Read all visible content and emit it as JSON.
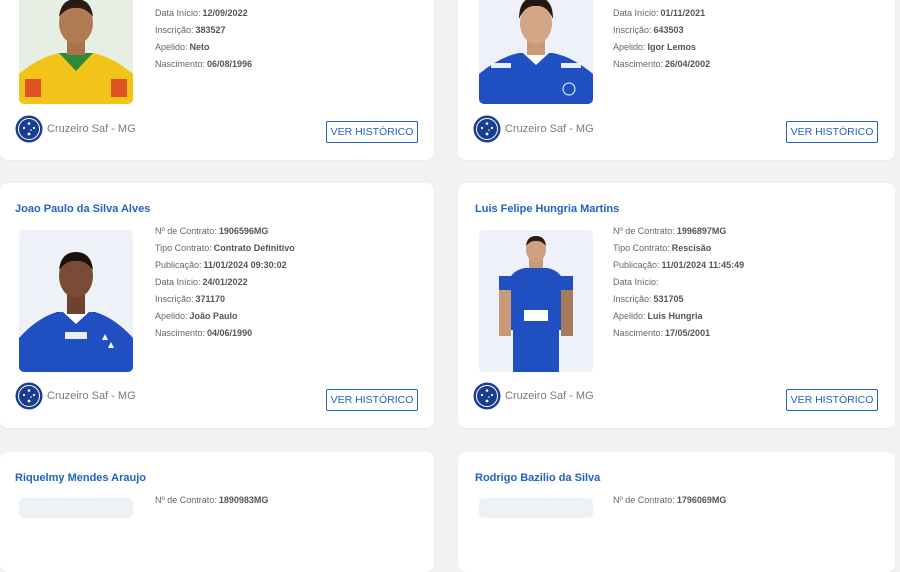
{
  "labels": {
    "contract_no": "Nº de Contrato:",
    "contract_type": "Tipo Contrato:",
    "publication": "Publicação:",
    "start_date": "Data Início:",
    "registration": "Inscrição:",
    "nickname": "Apelido:",
    "birth": "Nascimento:",
    "history_button": "VER HISTÓRICO"
  },
  "club": {
    "name": "Cruzeiro Saf - MG"
  },
  "colors": {
    "accent": "#2163c0",
    "cruzeiro_blue": "#1b3d8f"
  },
  "players": [
    {
      "name": "",
      "contract_no": "",
      "contract_type": "",
      "publication": "",
      "start_date": "12/09/2022",
      "registration": "383527",
      "nickname": "Neto",
      "birth": "06/08/1996",
      "photo": "player-photo-yellow-kit"
    },
    {
      "name": "",
      "contract_no": "",
      "contract_type": "",
      "publication": "",
      "start_date": "01/11/2021",
      "registration": "643503",
      "nickname": "Igor Lemos",
      "birth": "26/04/2002",
      "photo": "player-photo-blue-kit"
    },
    {
      "name": "Joao Paulo da Silva Alves",
      "contract_no": "1906596MG",
      "contract_type": "Contrato Definitivo",
      "publication": "11/01/2024 09:30:02",
      "start_date": "24/01/2022",
      "registration": "371170",
      "nickname": "João Paulo",
      "birth": "04/06/1990",
      "photo": "player-photo-blue-kit"
    },
    {
      "name": "Luis Felipe Hungria Martins",
      "contract_no": "1996897MG",
      "contract_type": "Rescisão",
      "publication": "11/01/2024 11:45:49",
      "start_date": "",
      "registration": "531705",
      "nickname": "Luis Hungria",
      "birth": "17/05/2001",
      "photo": "player-photo-full-body-blue-kit"
    },
    {
      "name": "Riquelmy Mendes Araujo",
      "contract_no": "1890983MG"
    },
    {
      "name": "Rodrigo Bazilio da Silva",
      "contract_no": "1796069MG"
    }
  ]
}
